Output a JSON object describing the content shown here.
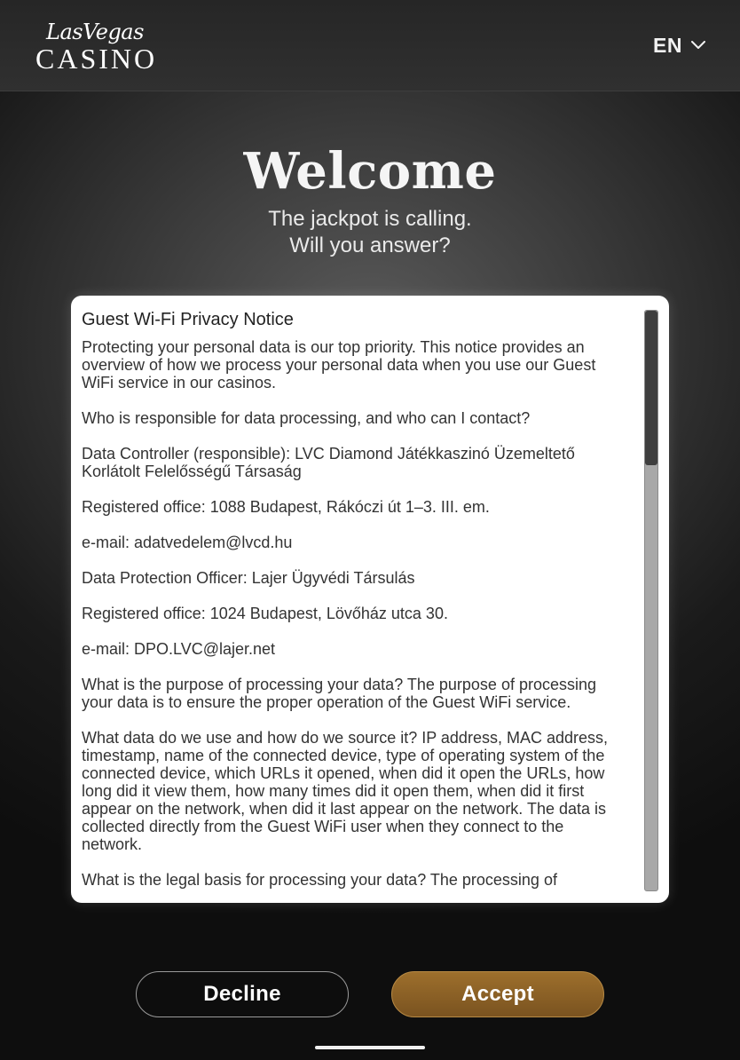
{
  "header": {
    "logo_script": "LasVegas",
    "logo_wordmark": "CASINO",
    "language": "EN"
  },
  "hero": {
    "title": "Welcome",
    "subtitle_line1": "The jackpot is calling.",
    "subtitle_line2": "Will you answer?"
  },
  "notice": {
    "title": "Guest Wi-Fi Privacy Notice",
    "paragraphs": [
      "Protecting your personal data is our top priority. This notice provides an overview of how we process your personal data when you use our Guest WiFi service in our casinos.",
      "Who is responsible for data processing, and who can I contact?",
      "Data Controller (responsible): LVC Diamond Játékkaszinó Üzemeltető Korlátolt Felelősségű Társaság",
      "Registered office: 1088 Budapest, Rákóczi út 1–3. III. em.",
      "e-mail: adatvedelem@lvcd.hu",
      "Data Protection Officer: Lajer Ügyvédi Társulás",
      "Registered office: 1024 Budapest, Lövőház utca 30.",
      "e-mail: DPO.LVC@lajer.net",
      "What is the purpose of processing your data? The purpose of processing your data is to ensure the proper operation of the Guest WiFi service.",
      "What data do we use and how do we source it? IP address, MAC address, timestamp, name of the connected device, type of operating system of the connected device, which URLs it opened, when did it open the URLs, how long did it view them, how many times did it open them, when did it first appear on the network, when did it last appear on the network. The data is collected directly from the Guest WiFi user when they connect to the network.",
      "What is the legal basis for processing your data? The processing of"
    ],
    "scroll_position_fraction": 0.0
  },
  "actions": {
    "decline_label": "Decline",
    "accept_label": "Accept"
  },
  "colors": {
    "accent": "#8c6226",
    "header_bg": "#2a2a2a"
  },
  "icons": {
    "language_dropdown": "chevron-down-icon"
  }
}
